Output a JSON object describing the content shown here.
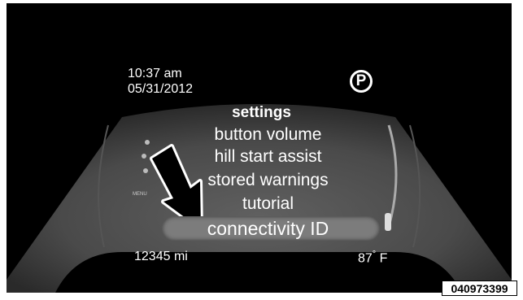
{
  "clock": {
    "time": "10:37 am",
    "date": "05/31/2012"
  },
  "gear_indicator": "P",
  "menu": {
    "title": "settings",
    "items": [
      "button volume",
      "hill start assist",
      "stored warnings",
      "tutorial"
    ],
    "selected": "connectivity ID"
  },
  "odometer": "12345 mi",
  "temperature": {
    "value": "87",
    "degree": "°",
    "unit": "F"
  },
  "figure_id": "040973399",
  "side_label": "MENU",
  "icons": [
    "parking-icon",
    "selection-arrow-icon",
    "nav-dots-icon",
    "speedometer-arc"
  ]
}
